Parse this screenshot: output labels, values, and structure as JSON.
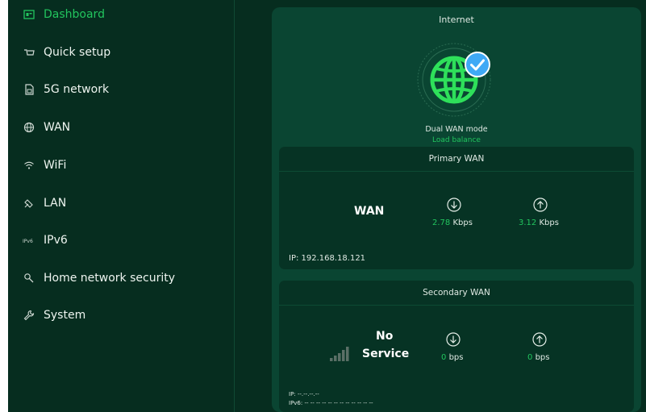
{
  "sidebar": {
    "items": [
      {
        "label": "Dashboard",
        "icon": "dashboard-icon",
        "active": true
      },
      {
        "label": "Quick setup",
        "icon": "quick-setup-icon"
      },
      {
        "label": "5G network",
        "icon": "sim-card-icon"
      },
      {
        "label": "WAN",
        "icon": "globe-icon"
      },
      {
        "label": "WiFi",
        "icon": "wifi-icon"
      },
      {
        "label": "LAN",
        "icon": "lan-icon"
      },
      {
        "label": "IPv6",
        "icon": "ipv6-icon"
      },
      {
        "label": "Home network security",
        "icon": "security-icon"
      },
      {
        "label": "System",
        "icon": "wrench-icon"
      }
    ]
  },
  "internet": {
    "title": "Internet",
    "mode": "Dual WAN mode",
    "mode_detail": "Load balance",
    "status_icon": "check-circle-icon"
  },
  "primary_wan": {
    "title": "Primary WAN",
    "name": "WAN",
    "download_value": "2.78",
    "download_unit": "Kbps",
    "upload_value": "3.12",
    "upload_unit": "Kbps",
    "ip": "IP: 192.168.18.121"
  },
  "secondary_wan": {
    "title": "Secondary WAN",
    "status_line1": "No",
    "status_line2": "Service",
    "download_value": "0",
    "download_unit": "bps",
    "upload_value": "0",
    "upload_unit": "bps",
    "ip": "IP: --.--.--.--",
    "ipv6": "IPv6: -- -- -- -- -- -- -- -- -- -- -- --"
  },
  "colors": {
    "background": "#062d1f",
    "card": "#0a4532",
    "panel": "#063324",
    "accent": "#22c55e"
  }
}
